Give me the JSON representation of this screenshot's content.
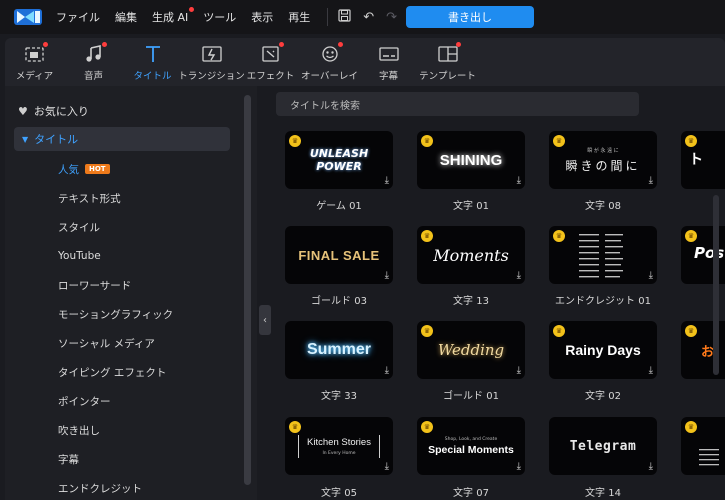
{
  "menubar": {
    "items": [
      "ファイル",
      "編集",
      "生成 AI",
      "ツール",
      "表示",
      "再生"
    ],
    "export_label": "書き出し"
  },
  "toolbar": {
    "tabs": [
      {
        "label": "メディア",
        "icon": "media-icon",
        "dot": true
      },
      {
        "label": "音声",
        "icon": "music-note-icon",
        "dot": true
      },
      {
        "label": "タイトル",
        "icon": "title-t-icon",
        "dot": false,
        "active": true
      },
      {
        "label": "トランジション",
        "icon": "transition-icon",
        "dot": false
      },
      {
        "label": "エフェクト",
        "icon": "effect-icon",
        "dot": true
      },
      {
        "label": "オーバーレイ",
        "icon": "overlay-icon",
        "dot": true
      },
      {
        "label": "字幕",
        "icon": "subtitle-icon",
        "dot": false
      },
      {
        "label": "テンプレート",
        "icon": "template-icon",
        "dot": true
      }
    ]
  },
  "sidebar": {
    "favorites": "お気に入り",
    "title_group": "タイトル",
    "items": [
      "人気",
      "テキスト形式",
      "スタイル",
      "YouTube",
      "ローワーサード",
      "モーショングラフィック",
      "ソーシャル メディア",
      "タイピング エフェクト",
      "ポインター",
      "吹き出し",
      "字幕",
      "エンドクレジット"
    ],
    "hot_badge": "HOT"
  },
  "search": {
    "placeholder": "タイトルを検索"
  },
  "cards": [
    {
      "preview": "UNLEASH POWER",
      "caption": "ゲーム 01"
    },
    {
      "preview": "SHINING",
      "caption": "文字 01"
    },
    {
      "preview": "瞬きの間に",
      "preview_small": "瞬 が 永 遠 に",
      "caption": "文字 08"
    },
    {
      "preview": "FINAL SALE",
      "caption": "ゴールド 03"
    },
    {
      "preview": "Moments",
      "caption": "文字 13"
    },
    {
      "preview": "",
      "caption": "エンドクレジット 01"
    },
    {
      "preview": "Summer",
      "caption": "文字 33"
    },
    {
      "preview": "Wedding",
      "caption": "ゴールド 01"
    },
    {
      "preview": "Rainy Days",
      "caption": "文字 02"
    },
    {
      "preview": "Kitchen Stories",
      "preview_small": "In Every Home",
      "caption": "文字 05"
    },
    {
      "preview": "Special Moments",
      "preview_small": "Shop, Look, and Create",
      "caption": "文字 07"
    },
    {
      "preview": "Telegram",
      "caption": "文字 14"
    }
  ],
  "colors": {
    "accent": "#3fa2ff",
    "export_button": "#1f8cf0",
    "hot_badge": "#ee7a1b",
    "crown": "#f3c21a",
    "notification_dot": "#ff3d3d"
  }
}
